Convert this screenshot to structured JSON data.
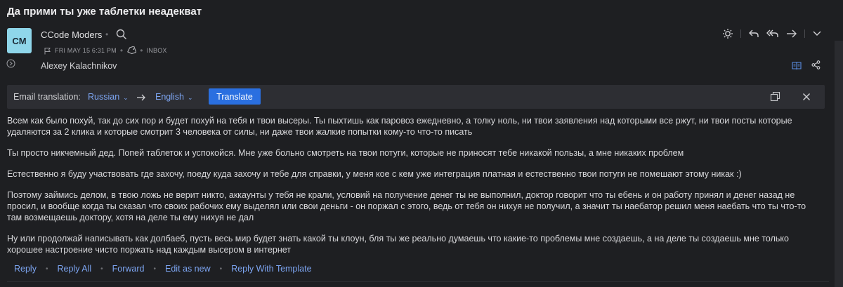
{
  "subject": "Да прими ты уже таблетки неадекват",
  "sender": {
    "initials": "CM",
    "name": "CCode Moders",
    "avatar_color": "#8fd6ea"
  },
  "meta": {
    "date": "FRI MAY 15 6:31 PM",
    "folder": "INBOX"
  },
  "recipient": "Alexey Kalachnikov",
  "translation": {
    "label": "Email translation:",
    "from_lang": "Russian",
    "to_lang": "English",
    "button": "Translate"
  },
  "body": [
    "Всем как было похуй, так до сих пор и будет похуй на тебя и твои высеры. Ты пыхтишь как паровоз ежедневно, а толку ноль, ни твои заявления над которыми все ржут, ни твои посты которые удаляются за 2 клика и которые смотрит 3 человека от силы, ни даже твои жалкие попытки кому-то что-то писать",
    "Ты просто никчемный дед. Попей таблеток и успокойся. Мне уже больно смотреть на твои потуги, которые не приносят тебе никакой пользы, а мне никаких проблем",
    "Естественно я буду участвовать где захочу, поеду куда захочу и тебе для справки, у меня кое с кем уже интеграция платная и естественно твои потуги не помешают этому никак :)",
    "Поэтому займись делом, в твою ложь не верит никто, аккаунты у тебя не крали, условий на получение денег ты не выполнил, доктор говорит что ты ебень и он работу принял и денег назад не просил, и вообще когда ты сказал что своих рабочих ему выделял или свои деньги - он поржал с этого, ведь от тебя он нихуя не получил, а значит ты наебатор решил меня наебать что ты что-то там возмещаешь доктору, хотя на деле ты ему нихуя не дал",
    "Ну или продолжай написывать как долбаеб, пусть весь мир будет знать какой ты клоун, бля ты же реально думаешь что какие-то проблемы мне создаешь, а на деле ты создаешь мне только хорошее настроение чисто поржать над каждым высером в интернет"
  ],
  "footer": {
    "reply": "Reply",
    "reply_all": "Reply All",
    "forward": "Forward",
    "edit_as_new": "Edit as new",
    "reply_template": "Reply With Template"
  },
  "colors": {
    "accent": "#2a6fe0",
    "link": "#7ca4f0",
    "background": "#1e1f22"
  },
  "icons": [
    "search-icon",
    "flag-icon",
    "tag-icon",
    "expand-icon",
    "brightness-icon",
    "reply-icon",
    "reply-all-icon",
    "forward-icon",
    "chevron-down-icon",
    "book-icon",
    "share-icon",
    "swap-arrow-icon",
    "copy-icon",
    "close-icon"
  ]
}
